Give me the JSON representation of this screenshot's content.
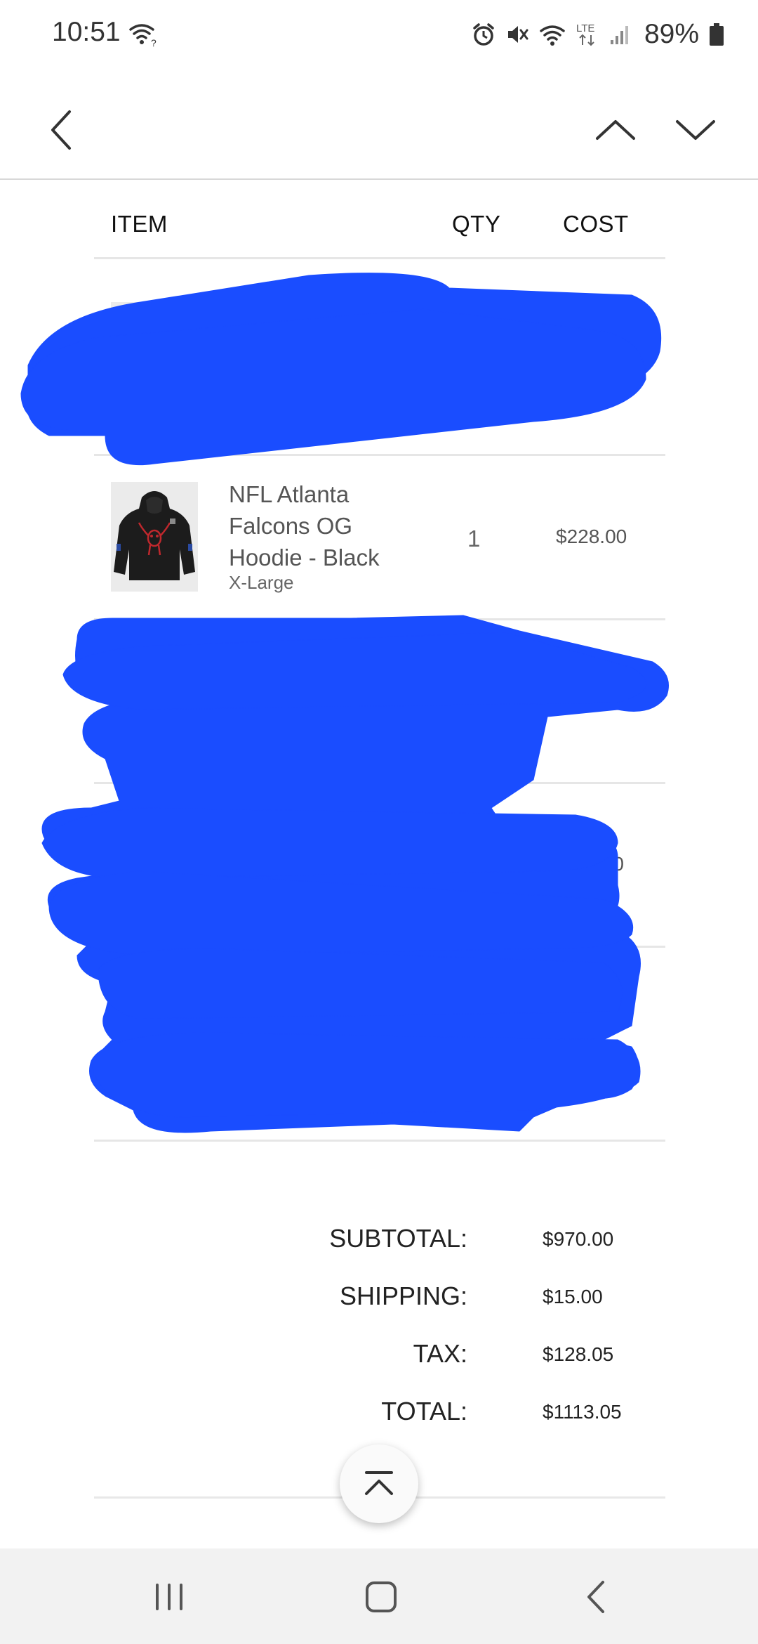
{
  "status_bar": {
    "time": "10:51",
    "battery": "89%",
    "icons": [
      "wifi-question-icon",
      "alarm-icon",
      "mute-icon",
      "wifi-icon",
      "lte-icon",
      "signal-icon",
      "battery-icon"
    ]
  },
  "appbar": {
    "icons": [
      "back-chevron-icon",
      "chevron-up-icon",
      "chevron-down-icon"
    ]
  },
  "table": {
    "headers": {
      "item": "ITEM",
      "qty": "QTY",
      "cost": "COST"
    },
    "rows": [
      {
        "name": "NFL Atlanta Falcons OG Hoodie - Black",
        "name_lines": [
          "NFL Atlanta",
          "Falcons OG",
          "Hoodie - Black"
        ],
        "variant": "X-Large",
        "qty": "1",
        "cost": "$228.00"
      }
    ],
    "partial_cost_visible": ".00"
  },
  "totals": {
    "subtotal_label": "SUBTOTAL:",
    "subtotal_value": "$970.00",
    "shipping_label": "SHIPPING:",
    "shipping_value": "$15.00",
    "tax_label": "TAX:",
    "tax_value": "$128.05",
    "total_label": "TOTAL:",
    "total_value": "$1113.05"
  },
  "colors": {
    "redaction": "#1a4dff",
    "hoodie": "#1c1c1c",
    "logo": "#c0282d"
  }
}
